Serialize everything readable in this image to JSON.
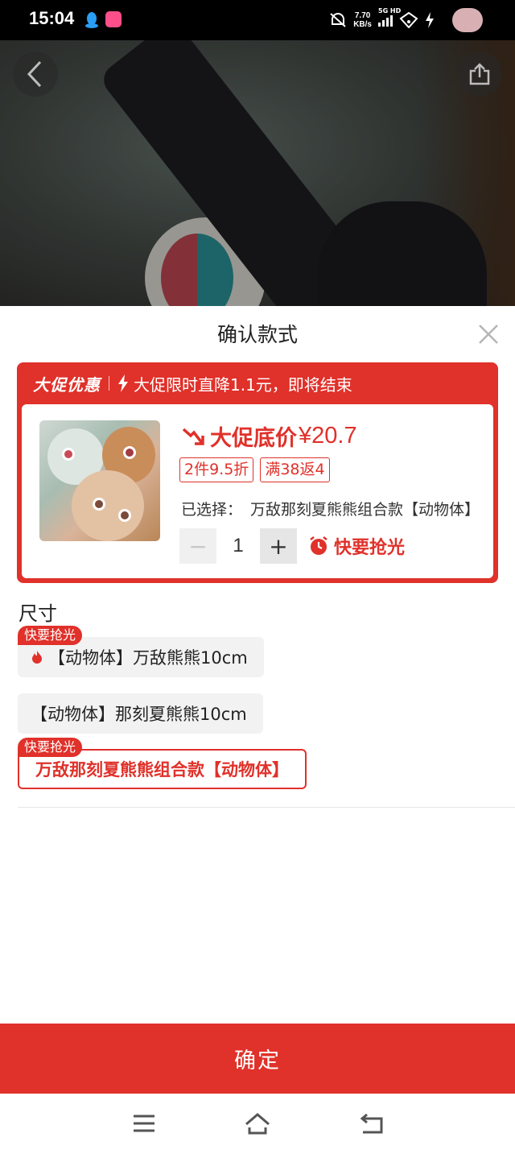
{
  "status_bar": {
    "time": "15:04",
    "net_speed_value": "7.70",
    "net_speed_unit": "KB/s",
    "network_label": "5G HD"
  },
  "sheet": {
    "title": "确认款式"
  },
  "promo": {
    "tag": "大促优惠",
    "message": "大促限时直降1.1元，即将结束",
    "price_label": "大促底价",
    "price_value": "¥20.7",
    "chips": [
      "2件9.5折",
      "满38返4"
    ],
    "selected_label": "已选择：",
    "selected_value": "万敌那刻夏熊熊组合款【动物体】",
    "quantity": "1",
    "stepper_minus": "−",
    "stepper_plus": "+",
    "hurry_label": "快要抢光"
  },
  "size": {
    "title": "尺寸",
    "options": [
      {
        "label": "【动物体】万敌熊熊10cm",
        "badge": "快要抢光"
      },
      {
        "label": "【动物体】那刻夏熊熊10cm"
      },
      {
        "label": "万敌那刻夏熊熊组合款【动物体】",
        "badge": "快要抢光",
        "selected": true
      }
    ]
  },
  "confirm_label": "确定",
  "colors": {
    "accent": "#e0312a",
    "option_bg": "#f2f2f2"
  },
  "icons": [
    "back-arrow-icon",
    "share-icon",
    "close-icon",
    "price-down-arrow-icon",
    "alarm-clock-icon",
    "fire-icon",
    "menu-icon",
    "home-icon",
    "back-icon"
  ]
}
